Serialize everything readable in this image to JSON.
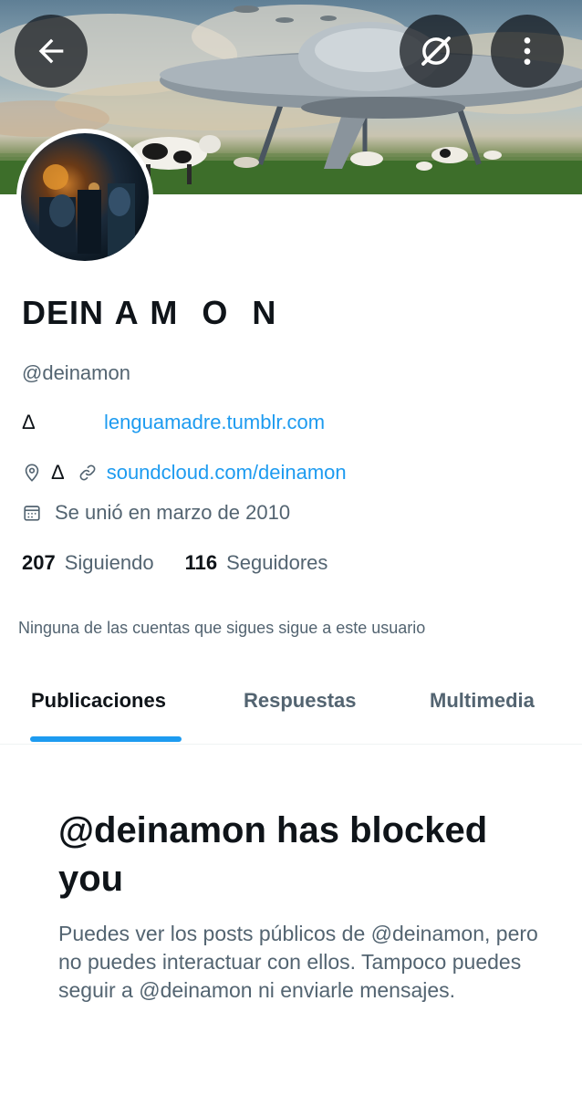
{
  "header": {
    "back_icon": "arrow-left-icon",
    "grok_icon": "grok-icon",
    "more_icon": "more-vertical-icon"
  },
  "profile": {
    "display_name": "DEIN A M  O  N",
    "handle": "@deinamon",
    "bio_symbol": "Δ",
    "bio_link": "lenguamadre.tumblr.com",
    "location": "Δ",
    "website": "soundcloud.com/deinamon",
    "joined": "Se unió en marzo de 2010",
    "following_count": "207",
    "following_label": "Siguiendo",
    "followers_count": "116",
    "followers_label": "Seguidores",
    "followers_note": "Ninguna de las cuentas que sigues sigue a este usuario"
  },
  "tabs": [
    {
      "label": "Publicaciones",
      "active": true
    },
    {
      "label": "Respuestas",
      "active": false
    },
    {
      "label": "Multimedia",
      "active": false
    }
  ],
  "blocked": {
    "title": "@deinamon has blocked you",
    "body": "Puedes ver los posts públicos de @deinamon, pero no puedes interactuar con ellos. Tampoco puedes seguir a @deinamon ni enviarle mensajes."
  },
  "colors": {
    "accent": "#1d9bf0",
    "text_primary": "#0f1419",
    "text_secondary": "#536471"
  }
}
